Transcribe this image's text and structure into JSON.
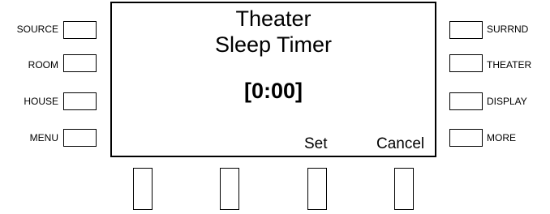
{
  "left_buttons": [
    {
      "label": "SOURCE"
    },
    {
      "label": "ROOM"
    },
    {
      "label": "HOUSE"
    },
    {
      "label": "MENU"
    }
  ],
  "right_buttons": [
    {
      "label": "SURRND"
    },
    {
      "label": "THEATER"
    },
    {
      "label": "DISPLAY"
    },
    {
      "label": "MORE"
    }
  ],
  "screen": {
    "title_line1": "Theater",
    "title_line2": "Sleep Timer",
    "timer_value": "[0:00]",
    "actions": {
      "set": "Set",
      "cancel": "Cancel"
    }
  }
}
